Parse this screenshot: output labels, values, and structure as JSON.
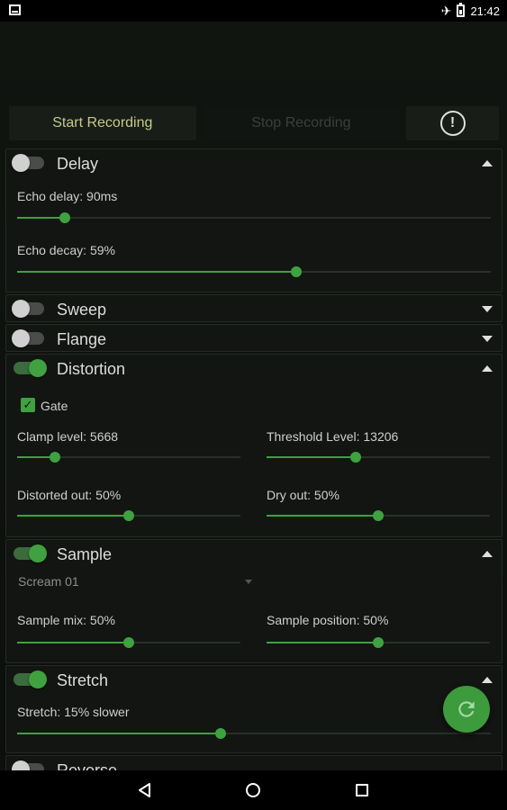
{
  "status_bar": {
    "time": "21:42",
    "airplane_glyph": "✈"
  },
  "controls": {
    "start_label": "Start Recording",
    "stop_label": "Stop Recording",
    "info_glyph": "!"
  },
  "effects": {
    "delay": {
      "title": "Delay",
      "enabled": false,
      "expanded": true,
      "echo_delay_label": "Echo delay: 90ms",
      "echo_delay_level": 0.1,
      "echo_decay_label": "Echo decay: 59%",
      "echo_decay_level": 0.59
    },
    "sweep": {
      "title": "Sweep",
      "enabled": false,
      "expanded": false
    },
    "flange": {
      "title": "Flange",
      "enabled": false,
      "expanded": false
    },
    "distortion": {
      "title": "Distortion",
      "enabled": true,
      "expanded": true,
      "gate_label": "Gate",
      "gate_checked": true,
      "clamp_label": "Clamp level: 5668",
      "clamp_level": 0.17,
      "threshold_label": "Threshold Level: 13206",
      "threshold_level": 0.4,
      "distorted_out_label": "Distorted out: 50%",
      "distorted_out_level": 0.5,
      "dry_out_label": "Dry out: 50%",
      "dry_out_level": 0.5
    },
    "sample": {
      "title": "Sample",
      "enabled": true,
      "expanded": true,
      "selected_sample": "Scream 01",
      "mix_label": "Sample mix: 50%",
      "mix_level": 0.5,
      "position_label": "Sample position: 50%",
      "position_level": 0.5
    },
    "stretch": {
      "title": "Stretch",
      "enabled": true,
      "expanded": true,
      "stretch_label": "Stretch: 15% slower",
      "stretch_level": 0.43
    },
    "reverse": {
      "title": "Reverse",
      "enabled": false
    }
  },
  "fab": {
    "icon": "refresh-icon"
  },
  "colors": {
    "accent": "#3fa13f",
    "background": "#0e120e",
    "panel": "#121512"
  }
}
